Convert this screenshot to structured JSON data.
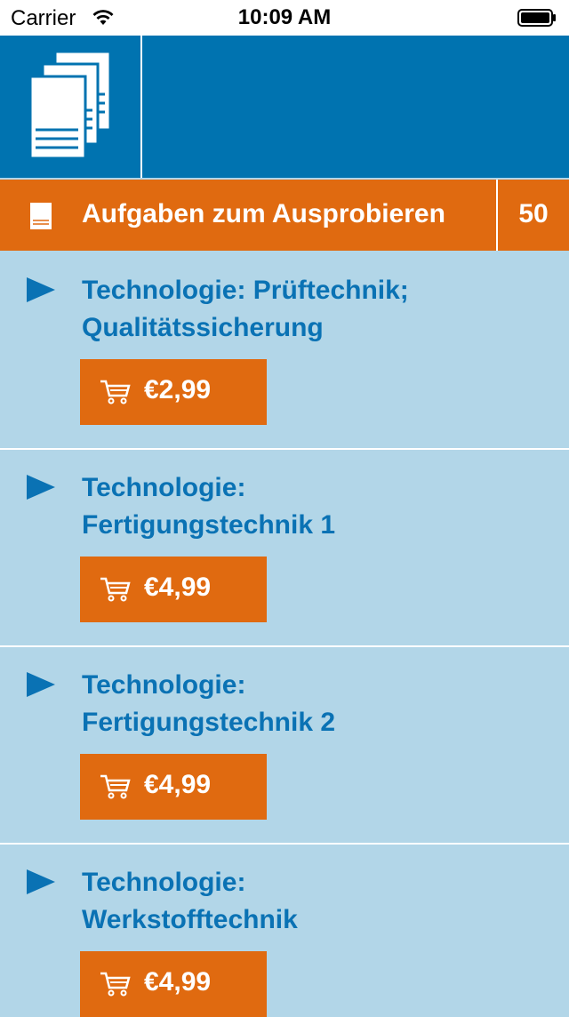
{
  "status_bar": {
    "carrier": "Carrier",
    "time": "10:09 AM"
  },
  "header": {
    "icon": "documents-stack-icon"
  },
  "section": {
    "title": "Aufgaben zum Ausprobieren",
    "count": "50",
    "icon": "document-icon"
  },
  "items": [
    {
      "title_line1": "Technologie: Prüftechnik;",
      "title_line2": "Qualitätssicherung",
      "price": "€2,99"
    },
    {
      "title_line1": "Technologie:",
      "title_line2": "Fertigungstechnik 1",
      "price": "€4,99"
    },
    {
      "title_line1": "Technologie:",
      "title_line2": "Fertigungstechnik 2",
      "price": "€4,99"
    },
    {
      "title_line1": "Technologie:",
      "title_line2": "Werkstofftechnik",
      "price": "€4,99"
    }
  ],
  "colors": {
    "header_blue": "#0073b0",
    "accent_orange": "#e06a10",
    "list_background": "#b2d6e8",
    "title_blue": "#0a72b4"
  }
}
